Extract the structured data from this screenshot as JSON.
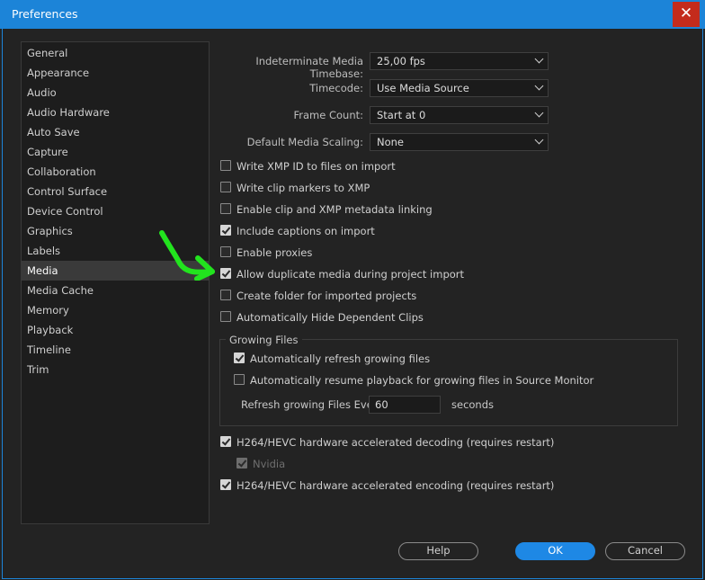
{
  "window": {
    "title": "Preferences",
    "close_glyph": "✕"
  },
  "sidebar": {
    "items": [
      {
        "label": "General"
      },
      {
        "label": "Appearance"
      },
      {
        "label": "Audio"
      },
      {
        "label": "Audio Hardware"
      },
      {
        "label": "Auto Save"
      },
      {
        "label": "Capture"
      },
      {
        "label": "Collaboration"
      },
      {
        "label": "Control Surface"
      },
      {
        "label": "Device Control"
      },
      {
        "label": "Graphics"
      },
      {
        "label": "Labels"
      },
      {
        "label": "Media"
      },
      {
        "label": "Media Cache"
      },
      {
        "label": "Memory"
      },
      {
        "label": "Playback"
      },
      {
        "label": "Timeline"
      },
      {
        "label": "Trim"
      }
    ],
    "selected": "Media"
  },
  "settings": {
    "timebase": {
      "label": "Indeterminate Media Timebase:",
      "value": "25,00 fps"
    },
    "timecode": {
      "label": "Timecode:",
      "value": "Use Media Source"
    },
    "frame_count": {
      "label": "Frame Count:",
      "value": "Start at 0"
    },
    "scaling": {
      "label": "Default Media Scaling:",
      "value": "None"
    }
  },
  "checkboxes": [
    {
      "label": "Write XMP ID to files on import",
      "checked": false
    },
    {
      "label": "Write clip markers to XMP",
      "checked": false
    },
    {
      "label": "Enable clip and XMP metadata linking",
      "checked": false
    },
    {
      "label": "Include captions on import",
      "checked": true
    },
    {
      "label": "Enable proxies",
      "checked": false
    },
    {
      "label": "Allow duplicate media during project import",
      "checked": true
    },
    {
      "label": "Create folder for imported projects",
      "checked": false
    },
    {
      "label": "Automatically Hide Dependent Clips",
      "checked": false
    }
  ],
  "growing_files": {
    "title": "Growing Files",
    "auto_refresh": {
      "label": "Automatically refresh growing files",
      "checked": true
    },
    "auto_resume": {
      "label": "Automatically resume playback for growing files in Source Monitor",
      "checked": false
    },
    "refresh_label": "Refresh growing Files Every",
    "refresh_value": "60",
    "refresh_unit": "seconds"
  },
  "hardware": {
    "decoding": {
      "label": "H264/HEVC hardware accelerated decoding (requires restart)",
      "checked": true
    },
    "nvidia": {
      "label": "Nvidia",
      "checked": true,
      "disabled": true
    },
    "encoding": {
      "label": "H264/HEVC hardware accelerated encoding (requires restart)",
      "checked": true
    }
  },
  "buttons": {
    "help": "Help",
    "ok": "OK",
    "cancel": "Cancel"
  },
  "colors": {
    "accent": "#1e88e5",
    "titlebar": "#1c84d8",
    "close": "#c42b1c",
    "annotation": "#22e31e"
  }
}
